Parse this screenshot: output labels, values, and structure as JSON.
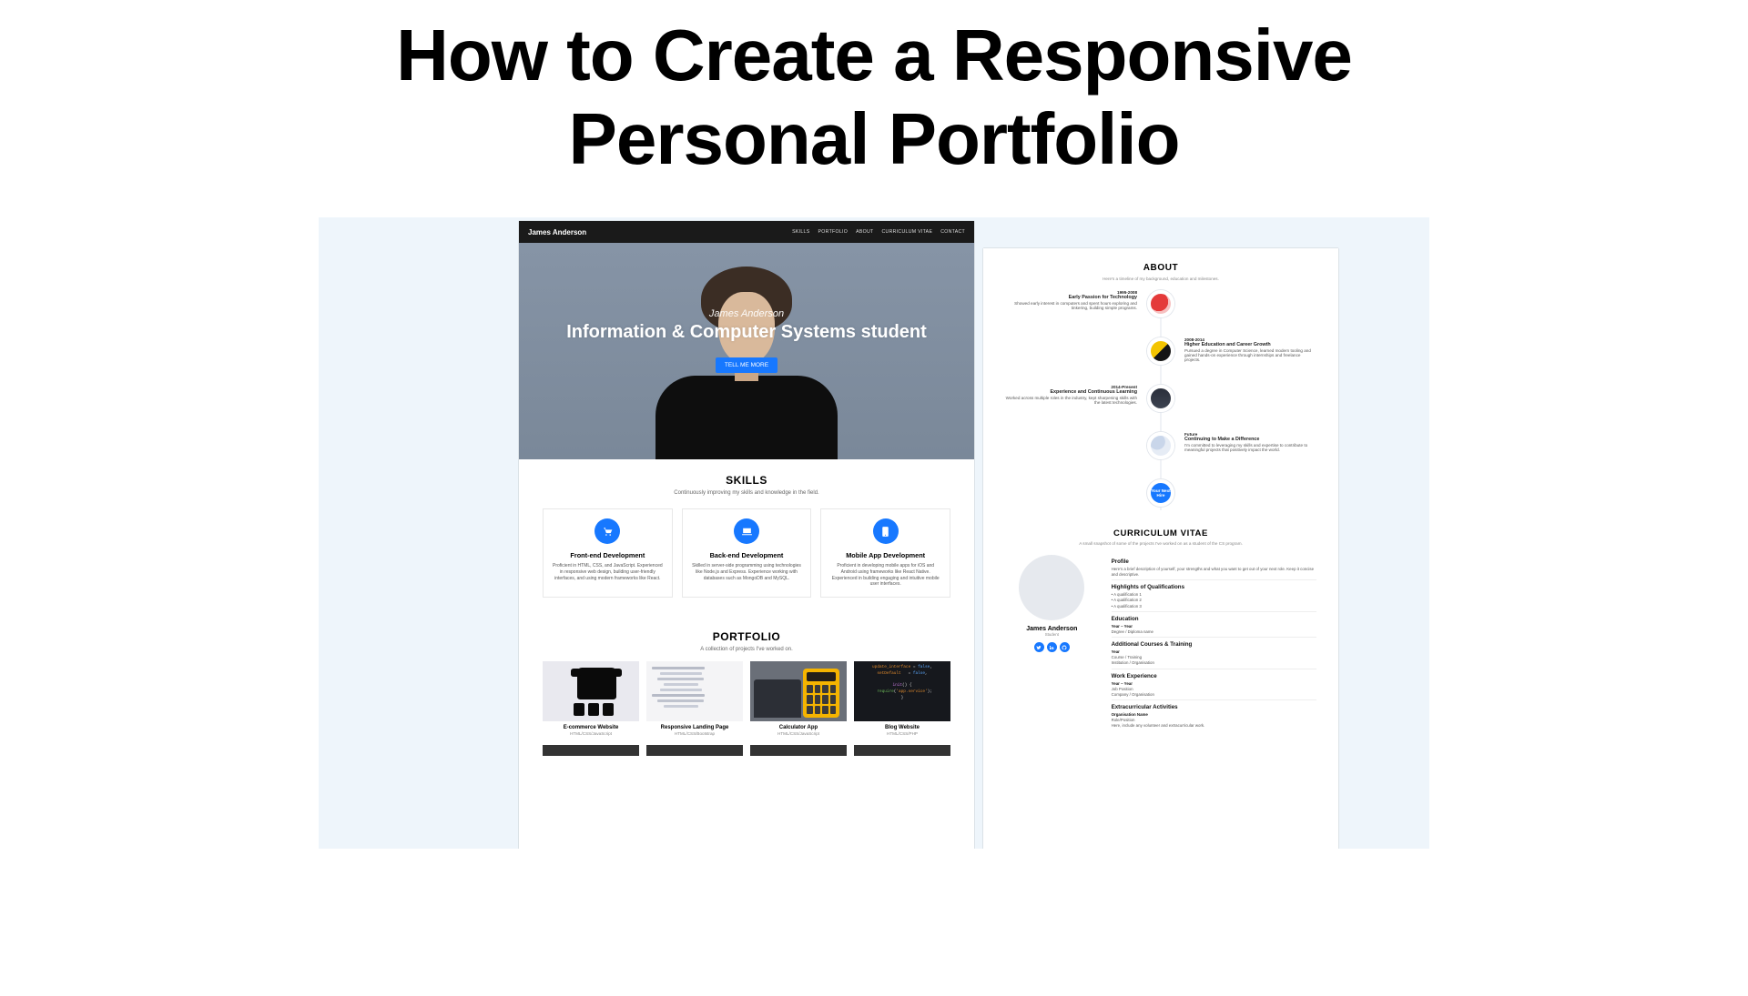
{
  "page": {
    "title": "How to Create a Responsive Personal Portfolio"
  },
  "left": {
    "brand": "James Anderson",
    "nav": [
      "SKILLS",
      "PORTFOLIO",
      "ABOUT",
      "CURRICULUM VITAE",
      "CONTACT"
    ],
    "hero": {
      "name": "James Anderson",
      "subtitle": "Information & Computer Systems student",
      "button": "TELL ME MORE"
    },
    "skills": {
      "heading": "SKILLS",
      "sub": "Continuously improving my skills and knowledge in the field.",
      "items": [
        {
          "title": "Front-end Development",
          "desc": "Proficient in HTML, CSS, and JavaScript. Experienced in responsive web design, building user-friendly interfaces, and using modern frameworks like React."
        },
        {
          "title": "Back-end Development",
          "desc": "Skilled in server-side programming using technologies like Node.js and Express. Experience working with databases such as MongoDB and MySQL."
        },
        {
          "title": "Mobile App Development",
          "desc": "Proficient in developing mobile apps for iOS and Android using frameworks like React Native. Experienced in building engaging and intuitive mobile user interfaces."
        }
      ]
    },
    "portfolio": {
      "heading": "PORTFOLIO",
      "sub": "A collection of projects I've worked on.",
      "items": [
        {
          "title": "E-commerce Website",
          "sub": "HTML/CSS/JavaScript"
        },
        {
          "title": "Responsive Landing Page",
          "sub": "HTML/CSS/Bootstrap"
        },
        {
          "title": "Calculator App",
          "sub": "HTML/CSS/JavaScript"
        },
        {
          "title": "Blog Website",
          "sub": "HTML/CSS/PHP"
        }
      ]
    }
  },
  "right": {
    "about": {
      "heading": "ABOUT",
      "sub": "Here's a timeline of my background, education and milestones.",
      "timeline": [
        {
          "side": "left",
          "period": "1995-2008",
          "title": "Early Passion for Technology",
          "text": "Showed early interest in computers and spent hours exploring and tinkering, building simple programs."
        },
        {
          "side": "right",
          "period": "2008-2014",
          "title": "Higher Education and Career Growth",
          "text": "Pursued a degree in Computer Science, learned modern tooling and gained hands-on experience through internships and freelance projects."
        },
        {
          "side": "left",
          "period": "2014-Present",
          "title": "Experience and Continuous Learning",
          "text": "Worked across multiple roles in the industry, kept sharpening skills with the latest technologies."
        },
        {
          "side": "right",
          "period": "Future",
          "title": "Continuing to Make a Difference",
          "text": "I'm committed to leveraging my skills and expertise to contribute to meaningful projects that positively impact the world."
        }
      ],
      "final_dot": "Your Next Hire"
    },
    "cv": {
      "heading": "CURRICULUM VITAE",
      "sub": "A small snapshot of some of the projects I've worked on as a student of the CS program.",
      "name": "James Anderson",
      "role": "Student",
      "sections": {
        "profile": {
          "title": "Profile",
          "text": "Here's a brief description of yourself, your strengths and what you want to get out of your next role. Keep it concise and descriptive."
        },
        "qual": {
          "title": "Highlights of Qualifications",
          "items": [
            "A qualification 1",
            "A qualification 2",
            "A qualification 3"
          ]
        },
        "edu": {
          "title": "Education",
          "period": "Year – Year",
          "line": "Degree / Diploma name"
        },
        "courses": {
          "title": "Additional Courses & Training",
          "period": "Year",
          "line1": "Course / Training",
          "line2": "Institution / Organisation"
        },
        "work": {
          "title": "Work Experience",
          "period": "Year – Year",
          "line1": "Job Position",
          "line2": "Company / Organisation"
        },
        "extra": {
          "title": "Extracurricular Activities",
          "line1": "Organisation Name",
          "line2": "Role/Position",
          "line3": "Here, include any volunteer and extracurricular work."
        }
      }
    }
  }
}
